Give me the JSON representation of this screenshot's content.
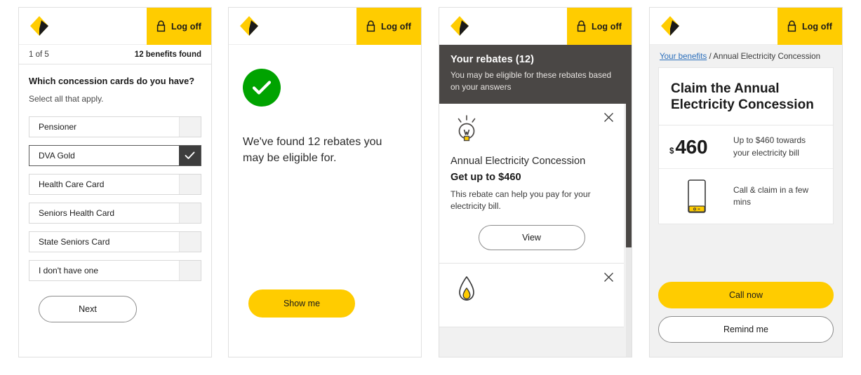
{
  "appbar": {
    "logo_name": "commbank-diamond-logo",
    "lock_icon": "lock-icon",
    "logoff_label": "Log off",
    "accent_yellow": "#FFCC00"
  },
  "panel1": {
    "progress_step": "1 of 5",
    "benefits_found": "12 benefits found",
    "question": "Which concession cards do you have?",
    "subnote": "Select all that apply.",
    "options": [
      {
        "label": "Pensioner",
        "selected": false
      },
      {
        "label": "DVA Gold",
        "selected": true
      },
      {
        "label": "Health Care Card",
        "selected": false
      },
      {
        "label": "Seniors Health Card",
        "selected": false
      },
      {
        "label": "State Seniors Card",
        "selected": false
      },
      {
        "label": "I don't have one",
        "selected": false
      }
    ],
    "next_label": "Next"
  },
  "panel2": {
    "success_icon": "green-check-circle-icon",
    "success_color": "#00A300",
    "message": "We've found 12 rebates you may be eligible for.",
    "showme_label": "Show me"
  },
  "panel3": {
    "header_title": "Your rebates (12)",
    "header_subtitle": "You may be eligible for these rebates based on your answers",
    "header_bg": "#4A4745",
    "cards": [
      {
        "icon": "lightbulb-icon",
        "title": "Annual Electricity Concession",
        "amount": "Get up to $460",
        "description": "This rebate can help you pay for your electricity bill.",
        "view_label": "View",
        "close_icon": "close-icon"
      },
      {
        "icon": "gas-flame-icon",
        "close_icon": "close-icon"
      }
    ]
  },
  "panel4": {
    "breadcrumb_link": "Your benefits",
    "breadcrumb_separator": " / ",
    "breadcrumb_current": "Annual Electricity Concession",
    "title": "Claim the Annual Electricity Concession",
    "amount_symbol": "$",
    "amount_value": "460",
    "amount_note": "Up to $460 towards your electricity bill",
    "phone_icon": "mobile-phone-icon",
    "phone_note": "Call & claim in a few mins",
    "call_label": "Call now",
    "remind_label": "Remind me"
  }
}
